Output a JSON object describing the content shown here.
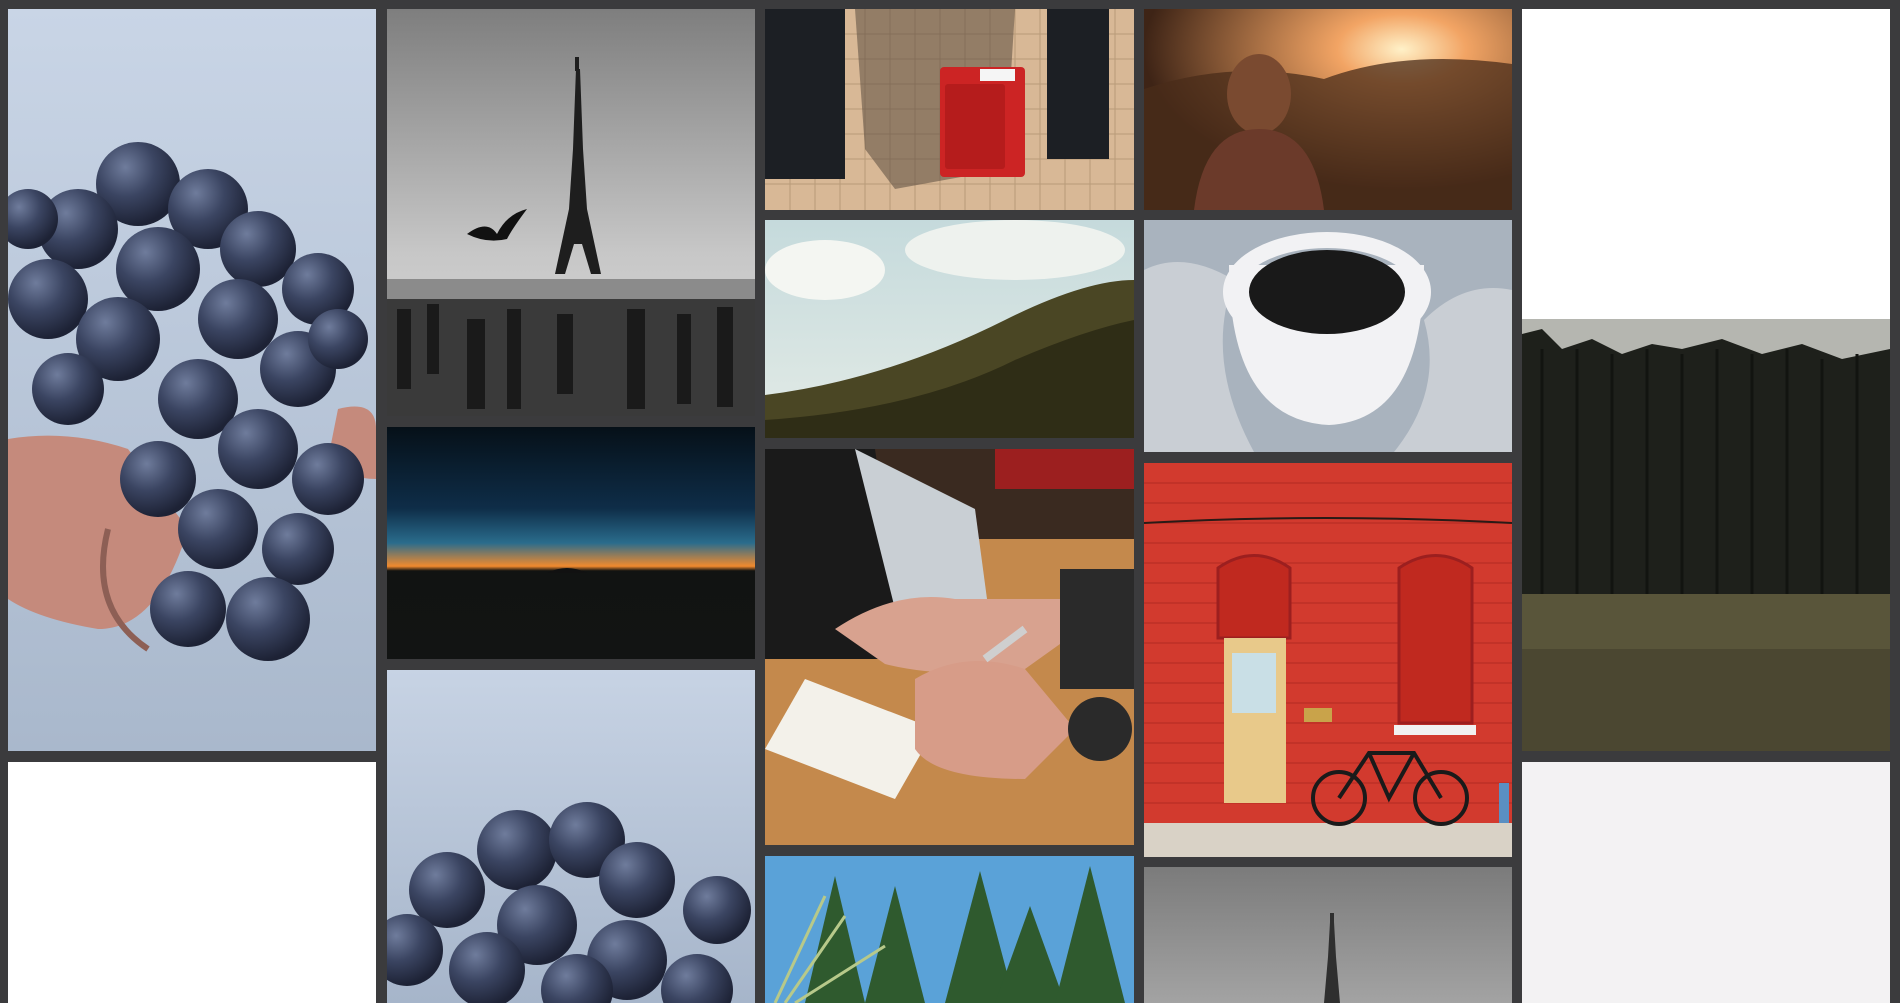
{
  "gallery": {
    "background_color": "#3b3b3d",
    "tiles": [
      {
        "subject": "grapes-in-hand",
        "palette": [
          "#b9c8db",
          "#3c4660",
          "#c98f80"
        ]
      },
      {
        "subject": "white-blank"
      },
      {
        "subject": "eiffel-tower-bw-with-bird",
        "palette": [
          "#a9a9a9",
          "#2a2a2a"
        ]
      },
      {
        "subject": "sunset-horizon-dark",
        "palette": [
          "#0a1c2c",
          "#f07a2a",
          "#111312"
        ]
      },
      {
        "subject": "grapes-in-hand",
        "palette": [
          "#b9c8db",
          "#3c4660"
        ]
      },
      {
        "subject": "red-alarm-box-on-tiled-wall",
        "palette": [
          "#cf2a2a",
          "#e5c9a5"
        ]
      },
      {
        "subject": "green-hillside-and-sky",
        "palette": [
          "#cfe0e2",
          "#4a4a25"
        ]
      },
      {
        "subject": "hand-writing-in-notebook-with-laptop",
        "palette": [
          "#c8894a",
          "#ececec",
          "#d8a08a"
        ]
      },
      {
        "subject": "pine-forest-treetops",
        "palette": [
          "#5a9fd5",
          "#2f5a2e"
        ]
      },
      {
        "subject": "sunset-backlit-woman",
        "palette": [
          "#f4b06a",
          "#4a2a1a"
        ]
      },
      {
        "subject": "coffee-cup-in-knit-mittens",
        "palette": [
          "#a7b1bc",
          "#1a1a1a"
        ]
      },
      {
        "subject": "red-brick-wall-door-and-bicycle",
        "palette": [
          "#d23a2e",
          "#e8c98a"
        ]
      },
      {
        "subject": "eiffel-tower-grey-sky",
        "palette": [
          "#8e8e8e",
          "#3a3a3a"
        ]
      },
      {
        "subject": "dark-forest-field-white-sky",
        "palette": [
          "#f4f4f4",
          "#1d1f1a",
          "#5b5638"
        ]
      },
      {
        "subject": "pale-grey-minimal",
        "palette": [
          "#f3f2f3"
        ]
      }
    ]
  }
}
